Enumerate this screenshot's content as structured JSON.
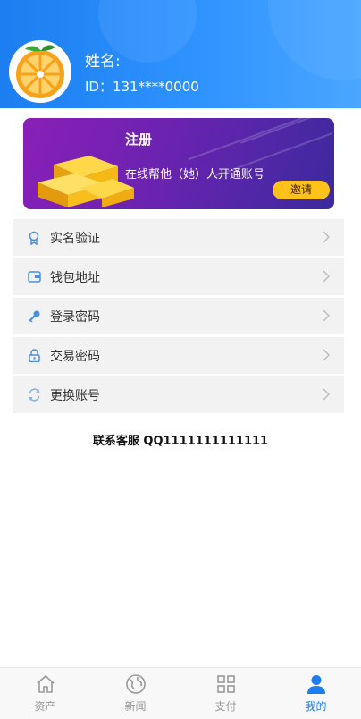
{
  "profile": {
    "name_label": "姓名:",
    "id_text": "ID：131****0000"
  },
  "banner": {
    "title": "注册",
    "description": "在线帮他（她）人开通账号",
    "invite_label": "邀请"
  },
  "menu": {
    "items": [
      {
        "label": "实名验证",
        "icon": "verify-icon"
      },
      {
        "label": "钱包地址",
        "icon": "wallet-icon"
      },
      {
        "label": "登录密码",
        "icon": "key-icon"
      },
      {
        "label": "交易密码",
        "icon": "lock-icon"
      },
      {
        "label": "更换账号",
        "icon": "refresh-icon"
      }
    ]
  },
  "contact": {
    "text": "联系客服 QQ1111111111111"
  },
  "tabbar": {
    "tabs": [
      {
        "label": "资产",
        "icon": "home-icon"
      },
      {
        "label": "新闻",
        "icon": "globe-icon"
      },
      {
        "label": "支付",
        "icon": "grid-icon"
      },
      {
        "label": "我的",
        "icon": "user-icon",
        "active": true
      }
    ]
  },
  "colors": {
    "primary": "#1c7ef0",
    "banner_start": "#8a1fb8",
    "banner_end": "#3b2a9e",
    "invite_button": "#ffc21a",
    "menu_bg": "#f2f2f2"
  }
}
